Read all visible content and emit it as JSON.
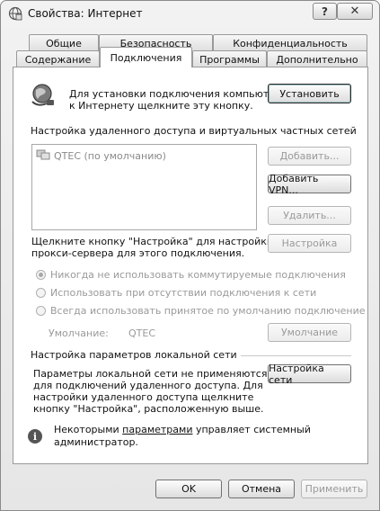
{
  "window": {
    "title": "Свойства: Интернет",
    "help_glyph": "?",
    "close_glyph": "✕"
  },
  "tabs_row1": [
    {
      "label": "Общие"
    },
    {
      "label": "Безопасность"
    },
    {
      "label": "Конфиденциальность"
    }
  ],
  "tabs_row2": [
    {
      "label": "Содержание"
    },
    {
      "label": "Подключения",
      "active": true
    },
    {
      "label": "Программы"
    },
    {
      "label": "Дополнительно"
    }
  ],
  "setup": {
    "text_line1": "Для установки подключения компьютера",
    "text_line2": "к Интернету щелкните эту кнопку.",
    "button": "Установить"
  },
  "dialup": {
    "section_title": "Настройка удаленного доступа и виртуальных частных сетей",
    "connections": [
      "QTEC (по умолчанию)"
    ],
    "add_button": "Добавить...",
    "add_vpn_button": "Добавить VPN...",
    "remove_button": "Удалить...",
    "settings_text_line1": "Щелкните кнопку \"Настройка\" для настройки",
    "settings_text_line2": "прокси-сервера для этого подключения.",
    "settings_button": "Настройка",
    "radio_options": [
      {
        "label": "Никогда не использовать коммутируемые подключения",
        "checked": true
      },
      {
        "label": "Использовать при отсутствии подключения к сети",
        "checked": false
      },
      {
        "label": "Всегда использовать принятое по умолчанию подключение",
        "checked": false
      }
    ],
    "default_label": "Умолчание:",
    "default_value": "QTEC",
    "default_button": "Умолчание"
  },
  "lan": {
    "section_title": "Настройка параметров локальной сети",
    "text_lines": [
      "Параметры локальной сети не применяются",
      "для подключений удаленного доступа. Для",
      "настройки удаленного доступа щелкните",
      "кнопку \"Настройка\", расположенную выше."
    ],
    "button": "Настройка сети"
  },
  "notice": {
    "icon": "info-icon",
    "glyph": "i",
    "text_before": "Некоторыми ",
    "link": "параметрами",
    "text_after": " управляет системный",
    "line2": "администратор."
  },
  "footer": {
    "ok": "OK",
    "cancel": "Отмена",
    "apply": "Применить"
  }
}
